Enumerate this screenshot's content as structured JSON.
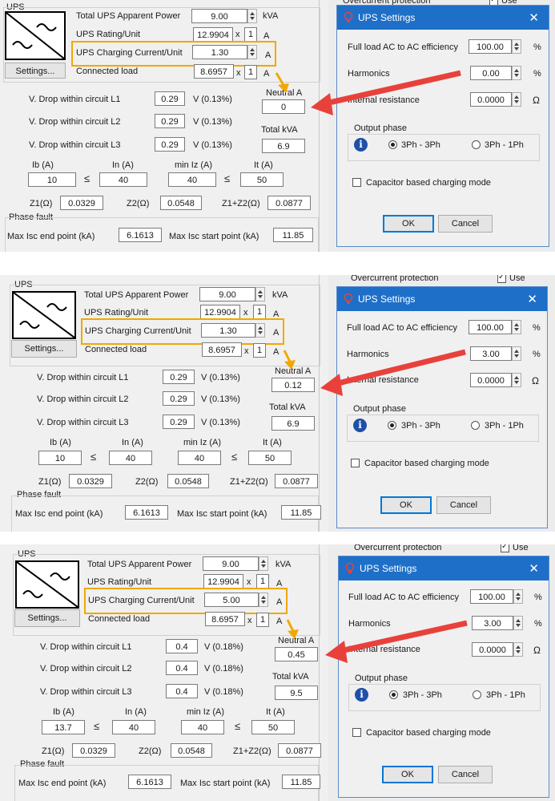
{
  "ups": {
    "section_label": "UPS",
    "total_apparent_power_label": "Total UPS Apparent Power",
    "rating_label": "UPS Rating/Unit",
    "charging_label": "UPS Charging Current/Unit",
    "connected_load_label": "Connected load",
    "settings_button": "Settings...",
    "kva_unit": "kVA",
    "amp_unit": "A",
    "times": "x",
    "units_count": "1"
  },
  "circuit": {
    "vdrop_l1": "V. Drop within circuit L1",
    "vdrop_l2": "V. Drop within circuit L2",
    "vdrop_l3": "V. Drop within circuit L3",
    "neutral_label": "Neutral A",
    "total_kva_label": "Total kVA",
    "ib_label": "Ib (A)",
    "in_label": "In (A)",
    "miniz_label": "min Iz (A)",
    "it_label": "It (A)",
    "le": "≤",
    "z1_label": "Z1(Ω)",
    "z2_label": "Z2(Ω)",
    "z1z2_label": "Z1+Z2(Ω)",
    "phase_fault_label": "Phase fault",
    "isc_end_label": "Max Isc end point (kA)",
    "isc_start_label": "Max Isc start point (kA)",
    "v_unit_label": "V"
  },
  "dialog": {
    "title": "UPS Settings",
    "close": "✕",
    "efficiency_label": "Full load AC to AC efficiency",
    "harmonics_label": "Harmonics",
    "internal_res_label": "Internal resistance",
    "percent": "%",
    "ohm": "Ω",
    "output_phase_label": "Output phase",
    "opt_3ph3ph": "3Ph - 3Ph",
    "opt_3ph1ph": "3Ph - 1Ph",
    "capacitor_label": "Capacitor based charging mode",
    "ok": "OK",
    "cancel": "Cancel"
  },
  "background": {
    "overcurrent_label": "Overcurrent protection",
    "use_label": "Use"
  },
  "scenarios": [
    {
      "total_apparent_power": "9.00",
      "rating": "12.9904",
      "charging": "1.30",
      "connected_load": "8.6957",
      "vdrop_l1": "0.29",
      "vdrop_l1_pct": "V (0.13%)",
      "vdrop_l2": "0.29",
      "vdrop_l2_pct": "V (0.13%)",
      "vdrop_l3": "0.29",
      "vdrop_l3_pct": "V (0.13%)",
      "neutral": "0",
      "total_kva": "6.9",
      "ib": "10",
      "in": "40",
      "miniz": "40",
      "it": "50",
      "z1": "0.0329",
      "z2": "0.0548",
      "z1z2": "0.0877",
      "isc_end": "6.1613",
      "isc_start": "11.85",
      "efficiency": "100.00",
      "harmonics": "0.00",
      "internal_res": "0.0000"
    },
    {
      "total_apparent_power": "9.00",
      "rating": "12.9904",
      "charging": "1.30",
      "connected_load": "8.6957",
      "vdrop_l1": "0.29",
      "vdrop_l1_pct": "V (0.13%)",
      "vdrop_l2": "0.29",
      "vdrop_l2_pct": "V (0.13%)",
      "vdrop_l3": "0.29",
      "vdrop_l3_pct": "V (0.13%)",
      "neutral": "0.12",
      "total_kva": "6.9",
      "ib": "10",
      "in": "40",
      "miniz": "40",
      "it": "50",
      "z1": "0.0329",
      "z2": "0.0548",
      "z1z2": "0.0877",
      "isc_end": "6.1613",
      "isc_start": "11.85",
      "efficiency": "100.00",
      "harmonics": "3.00",
      "internal_res": "0.0000"
    },
    {
      "total_apparent_power": "9.00",
      "rating": "12.9904",
      "charging": "5.00",
      "connected_load": "8.6957",
      "vdrop_l1": "0.4",
      "vdrop_l1_pct": "V (0.18%)",
      "vdrop_l2": "0.4",
      "vdrop_l2_pct": "V (0.18%)",
      "vdrop_l3": "0.4",
      "vdrop_l3_pct": "V (0.18%)",
      "neutral": "0.45",
      "total_kva": "9.5",
      "ib": "13.7",
      "in": "40",
      "miniz": "40",
      "it": "50",
      "z1": "0.0329",
      "z2": "0.0548",
      "z1z2": "0.0877",
      "isc_end": "6.1613",
      "isc_start": "11.85",
      "efficiency": "100.00",
      "harmonics": "3.00",
      "internal_res": "0.0000"
    }
  ],
  "colors": {
    "highlight": "#f0a800",
    "arrow": "#e8413c",
    "title_bar": "#1e6fc8"
  }
}
